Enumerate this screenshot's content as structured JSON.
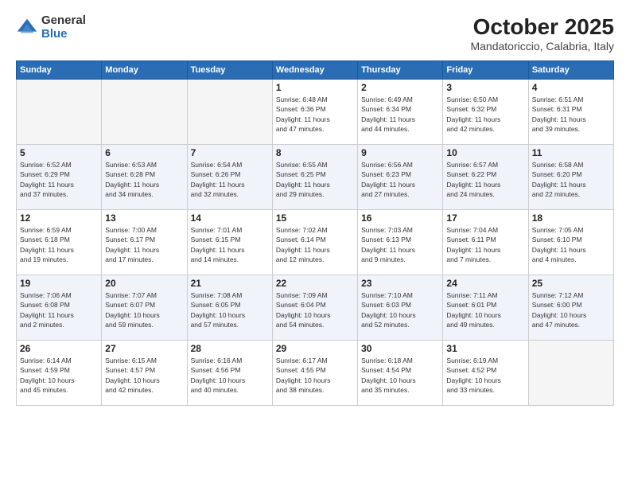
{
  "logo": {
    "general": "General",
    "blue": "Blue"
  },
  "header": {
    "month": "October 2025",
    "location": "Mandatoriccio, Calabria, Italy"
  },
  "weekdays": [
    "Sunday",
    "Monday",
    "Tuesday",
    "Wednesday",
    "Thursday",
    "Friday",
    "Saturday"
  ],
  "weeks": [
    [
      {
        "day": "",
        "info": ""
      },
      {
        "day": "",
        "info": ""
      },
      {
        "day": "",
        "info": ""
      },
      {
        "day": "1",
        "info": "Sunrise: 6:48 AM\nSunset: 6:36 PM\nDaylight: 11 hours\nand 47 minutes."
      },
      {
        "day": "2",
        "info": "Sunrise: 6:49 AM\nSunset: 6:34 PM\nDaylight: 11 hours\nand 44 minutes."
      },
      {
        "day": "3",
        "info": "Sunrise: 6:50 AM\nSunset: 6:32 PM\nDaylight: 11 hours\nand 42 minutes."
      },
      {
        "day": "4",
        "info": "Sunrise: 6:51 AM\nSunset: 6:31 PM\nDaylight: 11 hours\nand 39 minutes."
      }
    ],
    [
      {
        "day": "5",
        "info": "Sunrise: 6:52 AM\nSunset: 6:29 PM\nDaylight: 11 hours\nand 37 minutes."
      },
      {
        "day": "6",
        "info": "Sunrise: 6:53 AM\nSunset: 6:28 PM\nDaylight: 11 hours\nand 34 minutes."
      },
      {
        "day": "7",
        "info": "Sunrise: 6:54 AM\nSunset: 6:26 PM\nDaylight: 11 hours\nand 32 minutes."
      },
      {
        "day": "8",
        "info": "Sunrise: 6:55 AM\nSunset: 6:25 PM\nDaylight: 11 hours\nand 29 minutes."
      },
      {
        "day": "9",
        "info": "Sunrise: 6:56 AM\nSunset: 6:23 PM\nDaylight: 11 hours\nand 27 minutes."
      },
      {
        "day": "10",
        "info": "Sunrise: 6:57 AM\nSunset: 6:22 PM\nDaylight: 11 hours\nand 24 minutes."
      },
      {
        "day": "11",
        "info": "Sunrise: 6:58 AM\nSunset: 6:20 PM\nDaylight: 11 hours\nand 22 minutes."
      }
    ],
    [
      {
        "day": "12",
        "info": "Sunrise: 6:59 AM\nSunset: 6:18 PM\nDaylight: 11 hours\nand 19 minutes."
      },
      {
        "day": "13",
        "info": "Sunrise: 7:00 AM\nSunset: 6:17 PM\nDaylight: 11 hours\nand 17 minutes."
      },
      {
        "day": "14",
        "info": "Sunrise: 7:01 AM\nSunset: 6:15 PM\nDaylight: 11 hours\nand 14 minutes."
      },
      {
        "day": "15",
        "info": "Sunrise: 7:02 AM\nSunset: 6:14 PM\nDaylight: 11 hours\nand 12 minutes."
      },
      {
        "day": "16",
        "info": "Sunrise: 7:03 AM\nSunset: 6:13 PM\nDaylight: 11 hours\nand 9 minutes."
      },
      {
        "day": "17",
        "info": "Sunrise: 7:04 AM\nSunset: 6:11 PM\nDaylight: 11 hours\nand 7 minutes."
      },
      {
        "day": "18",
        "info": "Sunrise: 7:05 AM\nSunset: 6:10 PM\nDaylight: 11 hours\nand 4 minutes."
      }
    ],
    [
      {
        "day": "19",
        "info": "Sunrise: 7:06 AM\nSunset: 6:08 PM\nDaylight: 11 hours\nand 2 minutes."
      },
      {
        "day": "20",
        "info": "Sunrise: 7:07 AM\nSunset: 6:07 PM\nDaylight: 10 hours\nand 59 minutes."
      },
      {
        "day": "21",
        "info": "Sunrise: 7:08 AM\nSunset: 6:05 PM\nDaylight: 10 hours\nand 57 minutes."
      },
      {
        "day": "22",
        "info": "Sunrise: 7:09 AM\nSunset: 6:04 PM\nDaylight: 10 hours\nand 54 minutes."
      },
      {
        "day": "23",
        "info": "Sunrise: 7:10 AM\nSunset: 6:03 PM\nDaylight: 10 hours\nand 52 minutes."
      },
      {
        "day": "24",
        "info": "Sunrise: 7:11 AM\nSunset: 6:01 PM\nDaylight: 10 hours\nand 49 minutes."
      },
      {
        "day": "25",
        "info": "Sunrise: 7:12 AM\nSunset: 6:00 PM\nDaylight: 10 hours\nand 47 minutes."
      }
    ],
    [
      {
        "day": "26",
        "info": "Sunrise: 6:14 AM\nSunset: 4:59 PM\nDaylight: 10 hours\nand 45 minutes."
      },
      {
        "day": "27",
        "info": "Sunrise: 6:15 AM\nSunset: 4:57 PM\nDaylight: 10 hours\nand 42 minutes."
      },
      {
        "day": "28",
        "info": "Sunrise: 6:16 AM\nSunset: 4:56 PM\nDaylight: 10 hours\nand 40 minutes."
      },
      {
        "day": "29",
        "info": "Sunrise: 6:17 AM\nSunset: 4:55 PM\nDaylight: 10 hours\nand 38 minutes."
      },
      {
        "day": "30",
        "info": "Sunrise: 6:18 AM\nSunset: 4:54 PM\nDaylight: 10 hours\nand 35 minutes."
      },
      {
        "day": "31",
        "info": "Sunrise: 6:19 AM\nSunset: 4:52 PM\nDaylight: 10 hours\nand 33 minutes."
      },
      {
        "day": "",
        "info": ""
      }
    ]
  ]
}
